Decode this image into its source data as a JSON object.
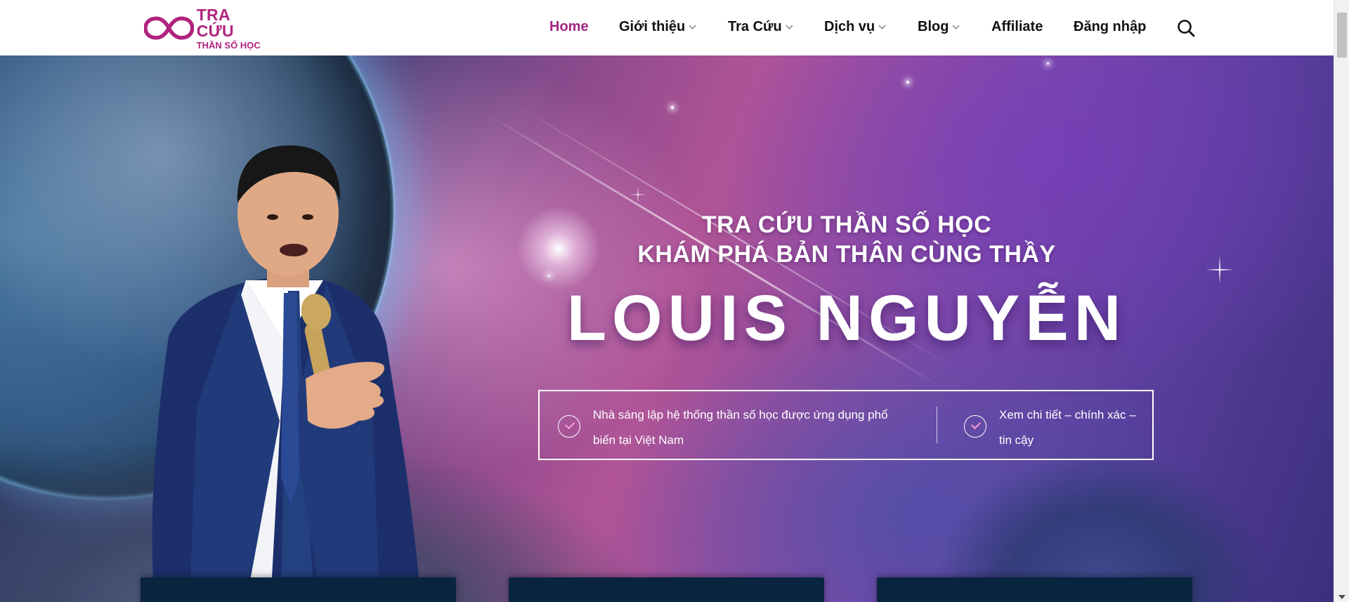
{
  "brand": {
    "line1": "TRA CỨU",
    "line2": "THẦN SỐ HỌC",
    "color": "#b0237e"
  },
  "nav": {
    "items": [
      {
        "label": "Home",
        "active": true,
        "dropdown": false
      },
      {
        "label": "Giới thiệu",
        "active": false,
        "dropdown": true
      },
      {
        "label": "Tra Cứu",
        "active": false,
        "dropdown": true
      },
      {
        "label": "Dịch vụ",
        "active": false,
        "dropdown": true
      },
      {
        "label": "Blog",
        "active": false,
        "dropdown": true
      },
      {
        "label": "Affiliate",
        "active": false,
        "dropdown": false
      },
      {
        "label": "Đăng nhập",
        "active": false,
        "dropdown": false
      }
    ],
    "search_icon": "search-icon",
    "active_color": "#a02783"
  },
  "hero": {
    "title_line1": "TRA CỨU THẦN SỐ HỌC",
    "title_line2": "KHÁM PHÁ BẢN THÂN CÙNG THẦY",
    "name": "LOUIS NGUYỄN",
    "features": [
      {
        "text_line1": "Nhà sáng lập hệ thống thần số học được ứng dụng phổ",
        "text_line2": "biến tại Việt Nam",
        "icon": "check-circle-icon"
      },
      {
        "text_line1": "Xem chi tiết – chính xác –",
        "text_line2": "tin cậy",
        "icon": "check-circle-icon"
      }
    ]
  }
}
